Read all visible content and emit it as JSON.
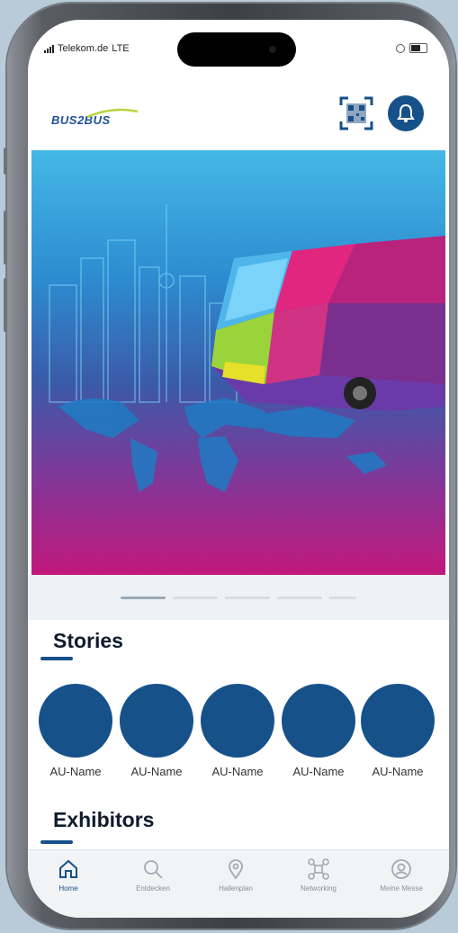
{
  "status": {
    "carrier": "Telekom.de",
    "network": "LTE"
  },
  "header": {
    "logo_text": "BUS2BUS",
    "qr_label": "qr-code-icon",
    "bell_label": "bell-icon"
  },
  "colors": {
    "brand": "#17518a",
    "background": "#ffffff",
    "tabbar": "#f2f3f5"
  },
  "carousel": {
    "active_index": 0,
    "count": 5
  },
  "stories": {
    "title": "Stories",
    "items": [
      {
        "label": "AU-Name"
      },
      {
        "label": "AU-Name"
      },
      {
        "label": "AU-Name"
      },
      {
        "label": "AU-Name"
      },
      {
        "label": "AU-Name"
      }
    ]
  },
  "exhibitors": {
    "title": "Exhibitors"
  },
  "tabs": [
    {
      "label": "Home",
      "icon": "home-icon",
      "active": true
    },
    {
      "label": "Entdecken",
      "icon": "search-icon",
      "active": false
    },
    {
      "label": "Hallenplan",
      "icon": "location-pin-icon",
      "active": false
    },
    {
      "label": "Networking",
      "icon": "network-icon",
      "active": false
    },
    {
      "label": "Meine Messe",
      "icon": "user-icon",
      "active": false
    }
  ]
}
